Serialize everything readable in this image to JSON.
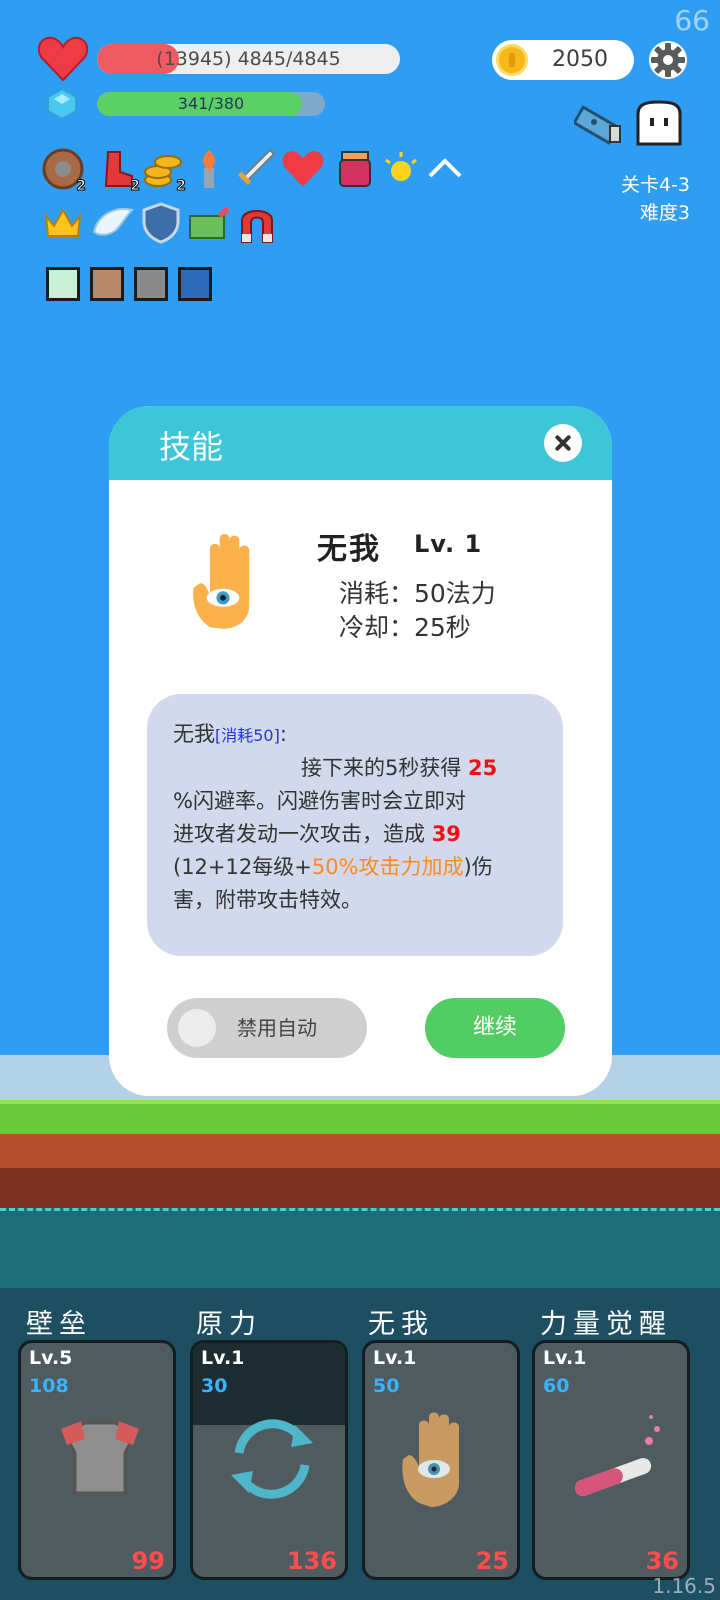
{
  "fps": "66",
  "hud": {
    "hp_text": "(13945) 4845/4845",
    "hp_fraction": 0.27,
    "mp_text": "341/380",
    "mp_fraction": 0.9,
    "coins": "2050",
    "stage": "关卡4-3",
    "difficulty": "难度3"
  },
  "items": [
    {
      "icon": "shield-round-icon",
      "count": "2"
    },
    {
      "icon": "red-boot-icon",
      "count": "2"
    },
    {
      "icon": "coin-stack-icon",
      "count": "2"
    },
    {
      "icon": "torch-icon",
      "count": ""
    },
    {
      "icon": "sword-icon",
      "count": ""
    },
    {
      "icon": "heart-item-icon",
      "count": ""
    },
    {
      "icon": "jam-jar-icon",
      "count": ""
    },
    {
      "icon": "sun-icon",
      "count": ""
    },
    {
      "icon": "collapse-chevron-icon",
      "count": ""
    },
    {
      "icon": "crown-icon",
      "count": ""
    },
    {
      "icon": "wing-icon",
      "count": ""
    },
    {
      "icon": "blue-shield-icon",
      "count": ""
    },
    {
      "icon": "money-icon",
      "count": ""
    },
    {
      "icon": "magnet-icon",
      "count": ""
    }
  ],
  "dialog": {
    "title": "技能",
    "skill_name": "无我",
    "skill_level": "Lv. 1",
    "cost": "消耗：50法力",
    "cooldown": "冷却：25秒",
    "desc_name": "无我",
    "desc_tag": "[消耗50]",
    "desc_colon": ":",
    "desc_l1": "接下来的5秒获得 ",
    "desc_v1": "25",
    "desc_l2": "%闪避率。闪避伤害时会立即对",
    "desc_l3": "进攻者发动一次攻击，造成 ",
    "desc_v2": "39",
    "desc_l4a": "(12+12每级+",
    "desc_l4b": "50%攻击力加成",
    "desc_l4c": ")伤",
    "desc_l5": "害，附带攻击特效。",
    "toggle_label": "禁用自动",
    "continue_label": "继续"
  },
  "skills": [
    {
      "name": "壁垒",
      "level": "Lv.5",
      "cost": "108",
      "count": "99"
    },
    {
      "name": "原力",
      "level": "Lv.1",
      "cost": "30",
      "count": "136"
    },
    {
      "name": "无我",
      "level": "Lv.1",
      "cost": "50",
      "count": "25"
    },
    {
      "name": "力量觉醒",
      "level": "Lv.1",
      "cost": "60",
      "count": "36"
    }
  ],
  "version": "1.16.5"
}
